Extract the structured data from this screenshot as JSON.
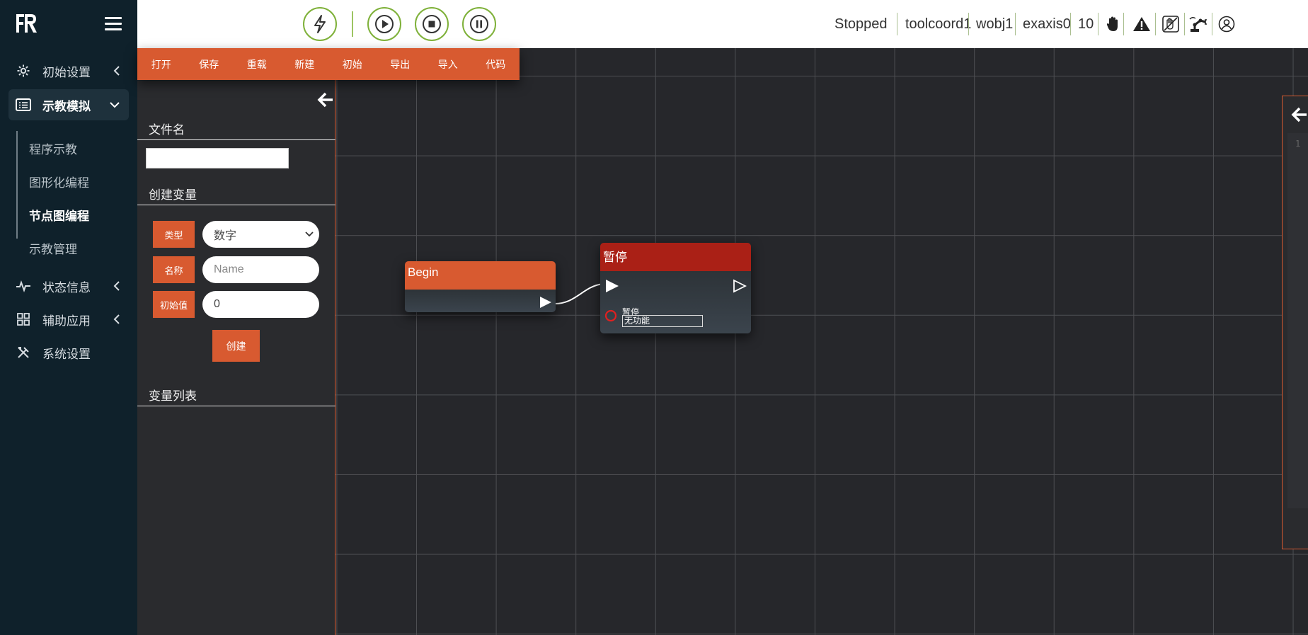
{
  "brand": {
    "logo_text": "FR"
  },
  "sidebar": {
    "items": [
      {
        "label": "初始设置",
        "icon": "gear-icon"
      },
      {
        "label": "示教模拟",
        "icon": "list-icon"
      },
      {
        "label": "状态信息",
        "icon": "pulse-icon"
      },
      {
        "label": "辅助应用",
        "icon": "grid-icon"
      },
      {
        "label": "系统设置",
        "icon": "tools-icon"
      }
    ],
    "subitems": [
      {
        "label": "程序示教"
      },
      {
        "label": "图形化编程"
      },
      {
        "label": "节点图编程"
      },
      {
        "label": "示教管理"
      }
    ],
    "active_item": "示教模拟",
    "active_subitem": "节点图编程"
  },
  "topbar": {
    "controls": [
      "lightning-icon",
      "play-icon",
      "stop-icon",
      "pause-icon"
    ],
    "status": "Stopped",
    "tool_coord": "toolcoord1",
    "work_obj": "wobj1",
    "ext_axis": "exaxis0",
    "speed": "10",
    "icons": [
      "hand-icon",
      "warning-icon",
      "hand-guide-icon",
      "robot-arm-icon",
      "user-icon"
    ]
  },
  "toolbar": {
    "buttons": [
      {
        "label": "打开"
      },
      {
        "label": "保存"
      },
      {
        "label": "重载"
      },
      {
        "label": "新建"
      },
      {
        "label": "初始"
      },
      {
        "label": "导出"
      },
      {
        "label": "导入"
      },
      {
        "label": "代码"
      }
    ]
  },
  "panel": {
    "filename_heading": "文件名",
    "filename_value": "",
    "create_var_heading": "创建变量",
    "type_label": "类型",
    "type_value": "数字",
    "name_label": "名称",
    "name_placeholder": "Name",
    "init_label": "初始值",
    "init_value": "0",
    "create_button": "创建",
    "var_list_heading": "变量列表"
  },
  "nodes": {
    "begin": {
      "title": "Begin",
      "color": "#d85a30"
    },
    "pause": {
      "title": "暂停",
      "color": "#aa2016",
      "field_label": "暂停",
      "field_value": "无功能"
    }
  },
  "code_panel": {
    "line_number": "1"
  },
  "colors": {
    "accent": "#d85a30",
    "sidebar_bg": "#0f212b",
    "control_ring": "#7fb13a",
    "canvas_bg": "#26272b"
  }
}
